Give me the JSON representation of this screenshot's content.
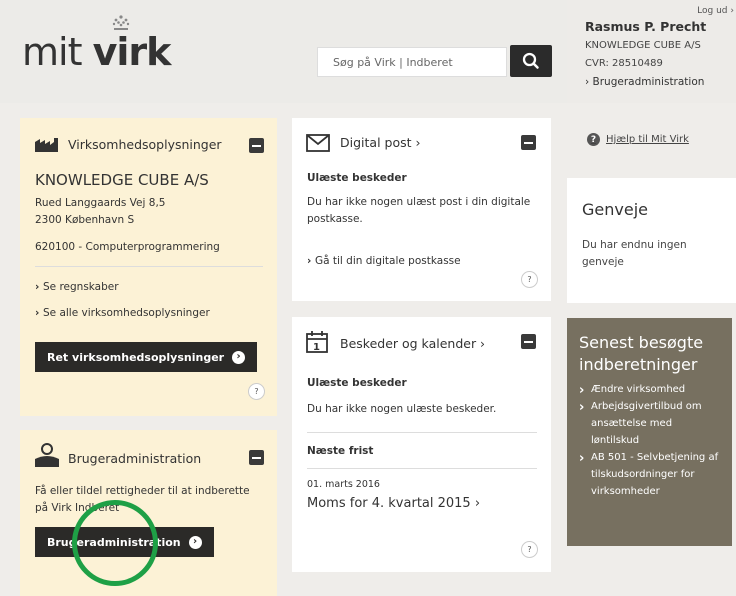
{
  "header": {
    "logo_light": "mit ",
    "logo_bold": "virk",
    "search_placeholder": "Søg på Virk | Indberet"
  },
  "user": {
    "logout": "Log ud ›",
    "name": "Rasmus P. Precht",
    "company": "KNOWLEDGE CUBE A/S",
    "cvr": "CVR: 28510489",
    "admin_link": "›  Brugeradministration"
  },
  "help": {
    "icon": "?",
    "label": "Hjælp til Mit Virk"
  },
  "genveje": {
    "title": "Genveje",
    "text": "Du har endnu ingen genveje"
  },
  "senest": {
    "title": "Senest besøgte indberetninger",
    "items": [
      "Ændre virksomhed",
      "Arbejdsgivertilbud om ansættelse med løntilskud",
      "AB 501 - Selvbetjening af tilskudsordninger for virksomheder"
    ]
  },
  "company_card": {
    "title": "Virksomhedsoplysninger",
    "name": "KNOWLEDGE CUBE A/S",
    "address1": "Rued Langgaards Vej 8,5",
    "address2": "2300 København S",
    "industry": "620100 - Computerprogrammering",
    "link1": "Se regnskaber",
    "link2": "Se alle virksomhedsoplysninger",
    "button": "Ret virksomhedsoplysninger",
    "help": "?"
  },
  "admin_card": {
    "title": "Brugeradministration",
    "text": "Få eller tildel rettigheder til at indberette på Virk Indberet",
    "button": "Brugeradministration"
  },
  "post_card": {
    "title": "Digital post ›",
    "subtitle": "Ulæste beskeder",
    "text": "Du har ikke nogen ulæst post i din digitale postkasse.",
    "link": "Gå til din digitale postkasse",
    "help": "?"
  },
  "calendar_card": {
    "title": "Beskeder og kalender ›",
    "subtitle": "Ulæste beskeder",
    "text": "Du har ikke nogen ulæste beskeder.",
    "deadline_label": "Næste frist",
    "date": "01. marts 2016",
    "deadline": "Moms for 4. kvartal 2015 ›",
    "help": "?"
  },
  "colors": {
    "accent_green": "#1ea046",
    "cream": "#fcf2d6",
    "dark": "#2b2a28",
    "taupe": "#777060"
  }
}
